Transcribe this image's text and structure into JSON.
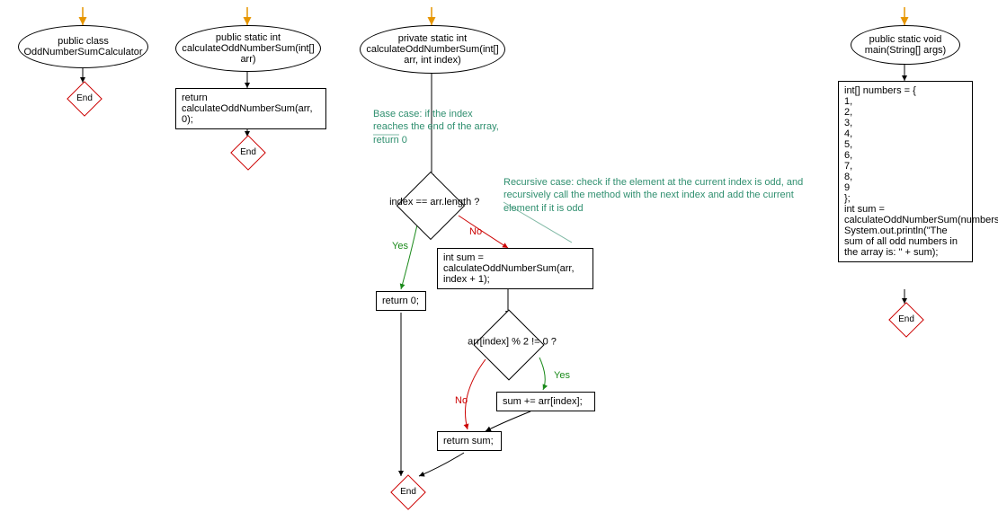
{
  "chart_data": {
    "type": "flowchart",
    "lanes": [
      {
        "name": "class",
        "start": "class_decl",
        "nodes": [
          {
            "id": "class_decl",
            "shape": "ellipse",
            "text": "public class OddNumberSumCalculator"
          },
          {
            "id": "end1",
            "shape": "end",
            "text": "End"
          }
        ],
        "edges": [
          {
            "from": "class_decl",
            "to": "end1"
          }
        ]
      },
      {
        "name": "public_method",
        "start": "pub_sig",
        "nodes": [
          {
            "id": "pub_sig",
            "shape": "ellipse",
            "text": "public static int calculateOddNumberSum(int[] arr)"
          },
          {
            "id": "pub_body",
            "shape": "rect",
            "text": "return calculateOddNumberSum(arr, 0);"
          },
          {
            "id": "end2",
            "shape": "end",
            "text": "End"
          }
        ],
        "edges": [
          {
            "from": "pub_sig",
            "to": "pub_body"
          },
          {
            "from": "pub_body",
            "to": "end2"
          }
        ]
      },
      {
        "name": "private_method",
        "start": "priv_sig",
        "nodes": [
          {
            "id": "priv_sig",
            "shape": "ellipse",
            "text": "private static int calculateOddNumberSum(int[] arr, int index)"
          },
          {
            "id": "comment_base",
            "shape": "comment",
            "text": "Base case: if the index reaches the end of the array, return 0"
          },
          {
            "id": "dec_base",
            "shape": "decision",
            "text": "index == arr.length ?"
          },
          {
            "id": "ret0",
            "shape": "rect",
            "text": "return 0;"
          },
          {
            "id": "comment_rec",
            "shape": "comment",
            "text": "Recursive case: check if the element at the current index is odd, and recursively call the method with the next index and add the current element if it is odd"
          },
          {
            "id": "rec_call",
            "shape": "rect",
            "text": "int sum = calculateOddNumberSum(arr, index + 1);"
          },
          {
            "id": "dec_odd",
            "shape": "decision",
            "text": "arr[index] % 2 != 0 ?"
          },
          {
            "id": "addsum",
            "shape": "rect",
            "text": "sum += arr[index];"
          },
          {
            "id": "retsum",
            "shape": "rect",
            "text": "return sum;"
          },
          {
            "id": "end3",
            "shape": "end",
            "text": "End"
          }
        ],
        "edges": [
          {
            "from": "priv_sig",
            "to": "dec_base",
            "via_comment": "comment_base"
          },
          {
            "from": "dec_base",
            "to": "ret0",
            "label": "Yes"
          },
          {
            "from": "dec_base",
            "to": "rec_call",
            "label": "No",
            "via_comment": "comment_rec"
          },
          {
            "from": "rec_call",
            "to": "dec_odd"
          },
          {
            "from": "dec_odd",
            "to": "addsum",
            "label": "Yes"
          },
          {
            "from": "dec_odd",
            "to": "retsum",
            "label": "No"
          },
          {
            "from": "addsum",
            "to": "retsum"
          },
          {
            "from": "ret0",
            "to": "end3"
          },
          {
            "from": "retsum",
            "to": "end3"
          }
        ]
      },
      {
        "name": "main",
        "start": "main_sig",
        "nodes": [
          {
            "id": "main_sig",
            "shape": "ellipse",
            "text": "public static void main(String[] args)"
          },
          {
            "id": "main_body",
            "shape": "rect",
            "text": "int[] numbers = {\n1,\n2,\n3,\n4,\n5,\n6,\n7,\n8,\n9\n};\nint sum = calculateOddNumberSum(numbers);\nSystem.out.println(\"The sum of all odd numbers in the array is: \" + sum);"
          },
          {
            "id": "end4",
            "shape": "end",
            "text": "End"
          }
        ],
        "edges": [
          {
            "from": "main_sig",
            "to": "main_body"
          },
          {
            "from": "main_body",
            "to": "end4"
          }
        ]
      }
    ]
  },
  "labels": {
    "end": "End",
    "yes": "Yes",
    "no": "No"
  },
  "colors": {
    "arrow_entry": "#e69500",
    "arrow_normal": "#000000",
    "yes": "#1a8a1a",
    "no": "#cc0000",
    "comment": "#2f8f6f",
    "comment_line": "#7fb8a4",
    "end_border": "#cc0000"
  }
}
